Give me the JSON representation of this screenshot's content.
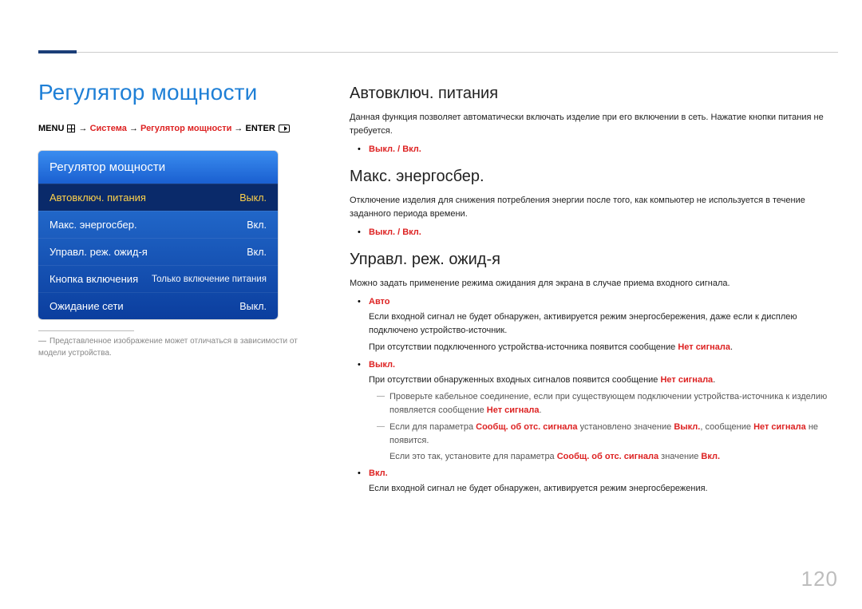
{
  "page_title": "Регулятор мощности",
  "breadcrumb": {
    "menu": "MENU",
    "arrow": "→",
    "system": "Система",
    "power": "Регулятор мощности",
    "enter": "ENTER"
  },
  "menu_panel": {
    "header": "Регулятор мощности",
    "rows": [
      {
        "label": "Автовключ. питания",
        "value": "Выкл."
      },
      {
        "label": "Макс. энергосбер.",
        "value": "Вкл."
      },
      {
        "label": "Управл. реж. ожид-я",
        "value": "Вкл."
      },
      {
        "label": "Кнопка включения",
        "value": "Только включение питания"
      },
      {
        "label": "Ожидание сети",
        "value": "Выкл."
      }
    ]
  },
  "footnote": "Представленное изображение может отличаться в зависимости от модели устройства.",
  "sections": {
    "auto_power": {
      "title": "Автовключ. питания",
      "desc": "Данная функция позволяет автоматически включать изделие при его включении в сеть. Нажатие кнопки питания не требуется.",
      "option": "Выкл. / Вкл."
    },
    "max_energy": {
      "title": "Макс. энергосбер.",
      "desc": "Отключение изделия для снижения потребления энергии после того, как компьютер не используется в течение заданного периода времени.",
      "option": "Выкл. / Вкл."
    },
    "standby": {
      "title": "Управл. реж. ожид-я",
      "desc": "Можно задать применение режима ожидания для экрана в случае приема входного сигнала.",
      "auto": {
        "label": "Авто",
        "line1": "Если входной сигнал не будет обнаружен, активируется режим энергосбережения, даже если к дисплею подключено устройство-источник.",
        "line2_pre": "При отсутствии подключенного устройства-источника появится сообщение ",
        "no_signal": "Нет сигнала",
        "line2_post": "."
      },
      "off": {
        "label": "Выкл.",
        "line1_pre": "При отсутствии обнаруженных входных сигналов появится сообщение ",
        "no_signal": "Нет сигнала",
        "line1_post": ".",
        "sub1_pre": "Проверьте кабельное соединение, если при существующем подключении устройства-источника к изделию появляется сообщение ",
        "sub1_post": ".",
        "sub2_a": "Если для параметра ",
        "sub2_param": "Сообщ. об отс. сигнала",
        "sub2_b": " установлено значение ",
        "sub2_val": "Выкл.",
        "sub2_c": ", сообщение ",
        "sub2_d": " не появится.",
        "sub3_a": "Если это так, установите для параметра ",
        "sub3_b": " значение ",
        "sub3_val": "Вкл."
      },
      "on": {
        "label": "Вкл.",
        "line": "Если входной сигнал не будет обнаружен, активируется режим энергосбережения."
      }
    }
  },
  "page_number": "120"
}
